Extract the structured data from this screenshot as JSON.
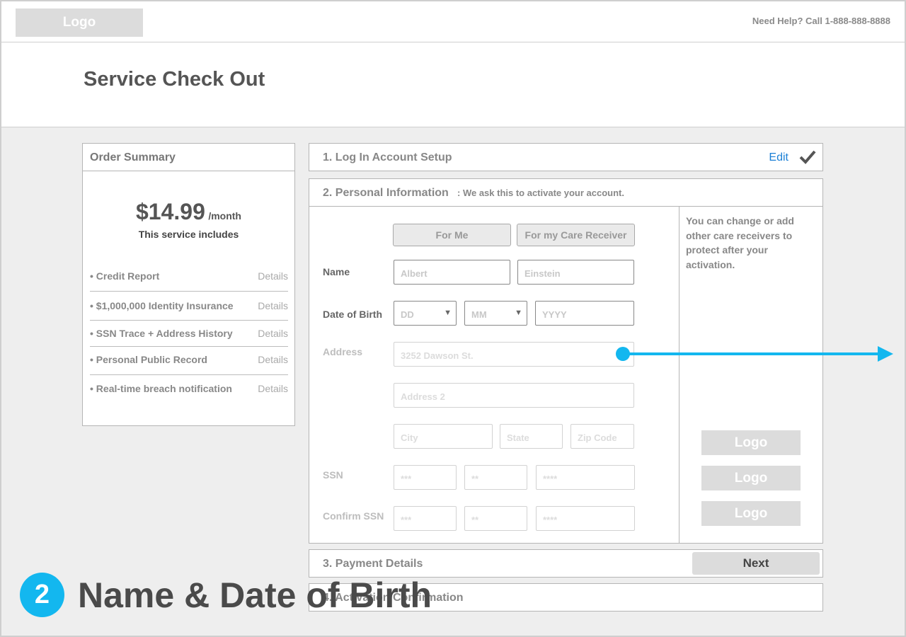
{
  "header": {
    "logo": "Logo",
    "help": "Need Help? Call 1-888-888-8888"
  },
  "page": {
    "title": "Service Check Out"
  },
  "summary": {
    "heading": "Order Summary",
    "price": "$14.99",
    "per": "/month",
    "includes": "This service includes",
    "items": [
      {
        "name": "Credit Report",
        "link": "Details"
      },
      {
        "name": "$1,000,000 Identity Insurance",
        "link": "Details"
      },
      {
        "name": "SSN Trace + Address History",
        "link": "Details"
      },
      {
        "name": "Personal Public Record",
        "link": "Details"
      },
      {
        "name": "Real-time breach notification",
        "link": "Details"
      }
    ]
  },
  "steps": {
    "step1": {
      "label": "1. Log In Account Setup",
      "edit": "Edit"
    },
    "step2": {
      "label": "2. Personal Information",
      "note": ": We ask this to activate your account."
    },
    "step3": {
      "label": "3. Payment Details"
    },
    "step4": {
      "label": "4. Activation Confirmation"
    }
  },
  "form": {
    "toggle_me": "For Me",
    "toggle_care": "For my Care Receiver",
    "name_label": "Name",
    "first_name": "Albert",
    "last_name": "Einstein",
    "dob_label": "Date of Birth",
    "dd": "DD",
    "mm": "MM",
    "yyyy": "YYYY",
    "address_label": "Address",
    "address1": "3252 Dawson St.",
    "address2": "Address 2",
    "city": "City",
    "state": "State",
    "zip": "Zip Code",
    "ssn_label": "SSN",
    "confirm_ssn_label": "Confirm SSN",
    "ssn1": "***",
    "ssn2": "**",
    "ssn3": "****"
  },
  "side": {
    "note": "You can change or add other care receivers to protect after your activation.",
    "logos": [
      "Logo",
      "Logo",
      "Logo"
    ]
  },
  "next_label": "Next",
  "annotation": {
    "number": "2",
    "text": "Name & Date of Birth",
    "color": "#13b7ef"
  }
}
